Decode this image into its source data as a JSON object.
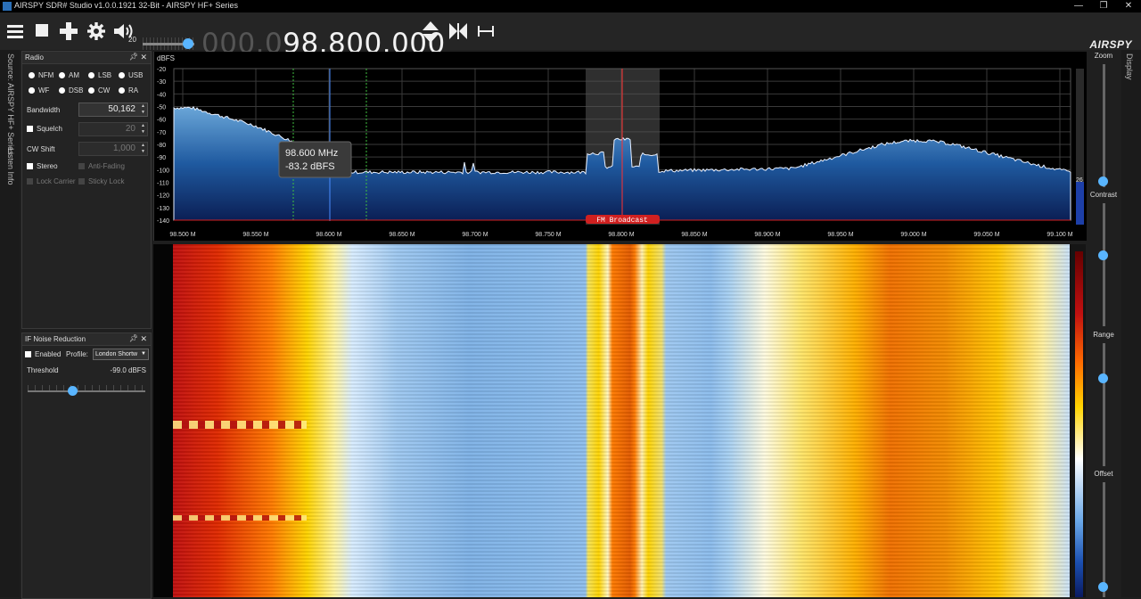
{
  "window": {
    "title": "AIRSPY SDR# Studio v1.0.0.1921 32-Bit - AIRSPY HF+ Series",
    "minimize_glyph": "—",
    "restore_glyph": "❐",
    "close_glyph": "✕"
  },
  "toolbar": {
    "menu_icon": "hamburger-menu-icon",
    "stop_icon": "stop-icon",
    "add_icon": "plus-icon",
    "settings_icon": "gear-icon",
    "volume_icon": "speaker-icon",
    "volume_value": "20",
    "volume_level_fraction": 0.88,
    "frequency_dim": "000.0",
    "frequency_bright": "98.800.000",
    "brand": "AIRSPY"
  },
  "left_tabs": {
    "source": "Source: AIRSPY HF+ Series",
    "listen": "Listen Info"
  },
  "right_tabs": {
    "display": "Display"
  },
  "radio_panel": {
    "title": "Radio",
    "modes": [
      "NFM",
      "AM",
      "LSB",
      "USB",
      "WF",
      "DSB",
      "CW",
      "RA"
    ],
    "selected_mode": "WF",
    "bandwidth_label": "Bandwidth",
    "bandwidth_value": "50,162",
    "squelch_label": "Squelch",
    "squelch_value": "20",
    "cw_shift_label": "CW Shift",
    "cw_shift_value": "1,000",
    "stereo_label": "Stereo",
    "anti_fading_label": "Anti-Fading",
    "lock_carrier_label": "Lock Carrier",
    "sticky_lock_label": "Sticky Lock"
  },
  "if_panel": {
    "title": "IF Noise Reduction",
    "enabled_label": "Enabled",
    "profile_label": "Profile:",
    "profile_value": "London Shortw",
    "threshold_label": "Threshold",
    "threshold_value": "-99.0 dBFS",
    "threshold_fraction": 0.38
  },
  "spectrum": {
    "unit_label": "dBFS",
    "y_ticks": [
      "-20",
      "-30",
      "-40",
      "-50",
      "-60",
      "-70",
      "-80",
      "-90",
      "-100",
      "-110",
      "-120",
      "-130",
      "-140"
    ],
    "x_ticks": [
      "98.500 M",
      "98.550 M",
      "98.600 M",
      "98.650 M",
      "98.700 M",
      "98.750 M",
      "98.800 M",
      "98.850 M",
      "98.900 M",
      "98.950 M",
      "99.000 M",
      "99.050 M",
      "99.100 M"
    ],
    "tooltip_freq": "98.600 MHz",
    "tooltip_level": "-83.2 dBFS",
    "band_label": "FM Broadcast",
    "level_readout": "26"
  },
  "right_controls": {
    "zoom_label": "Zoom",
    "contrast_label": "Contrast",
    "range_label": "Range",
    "offset_label": "Offset"
  }
}
